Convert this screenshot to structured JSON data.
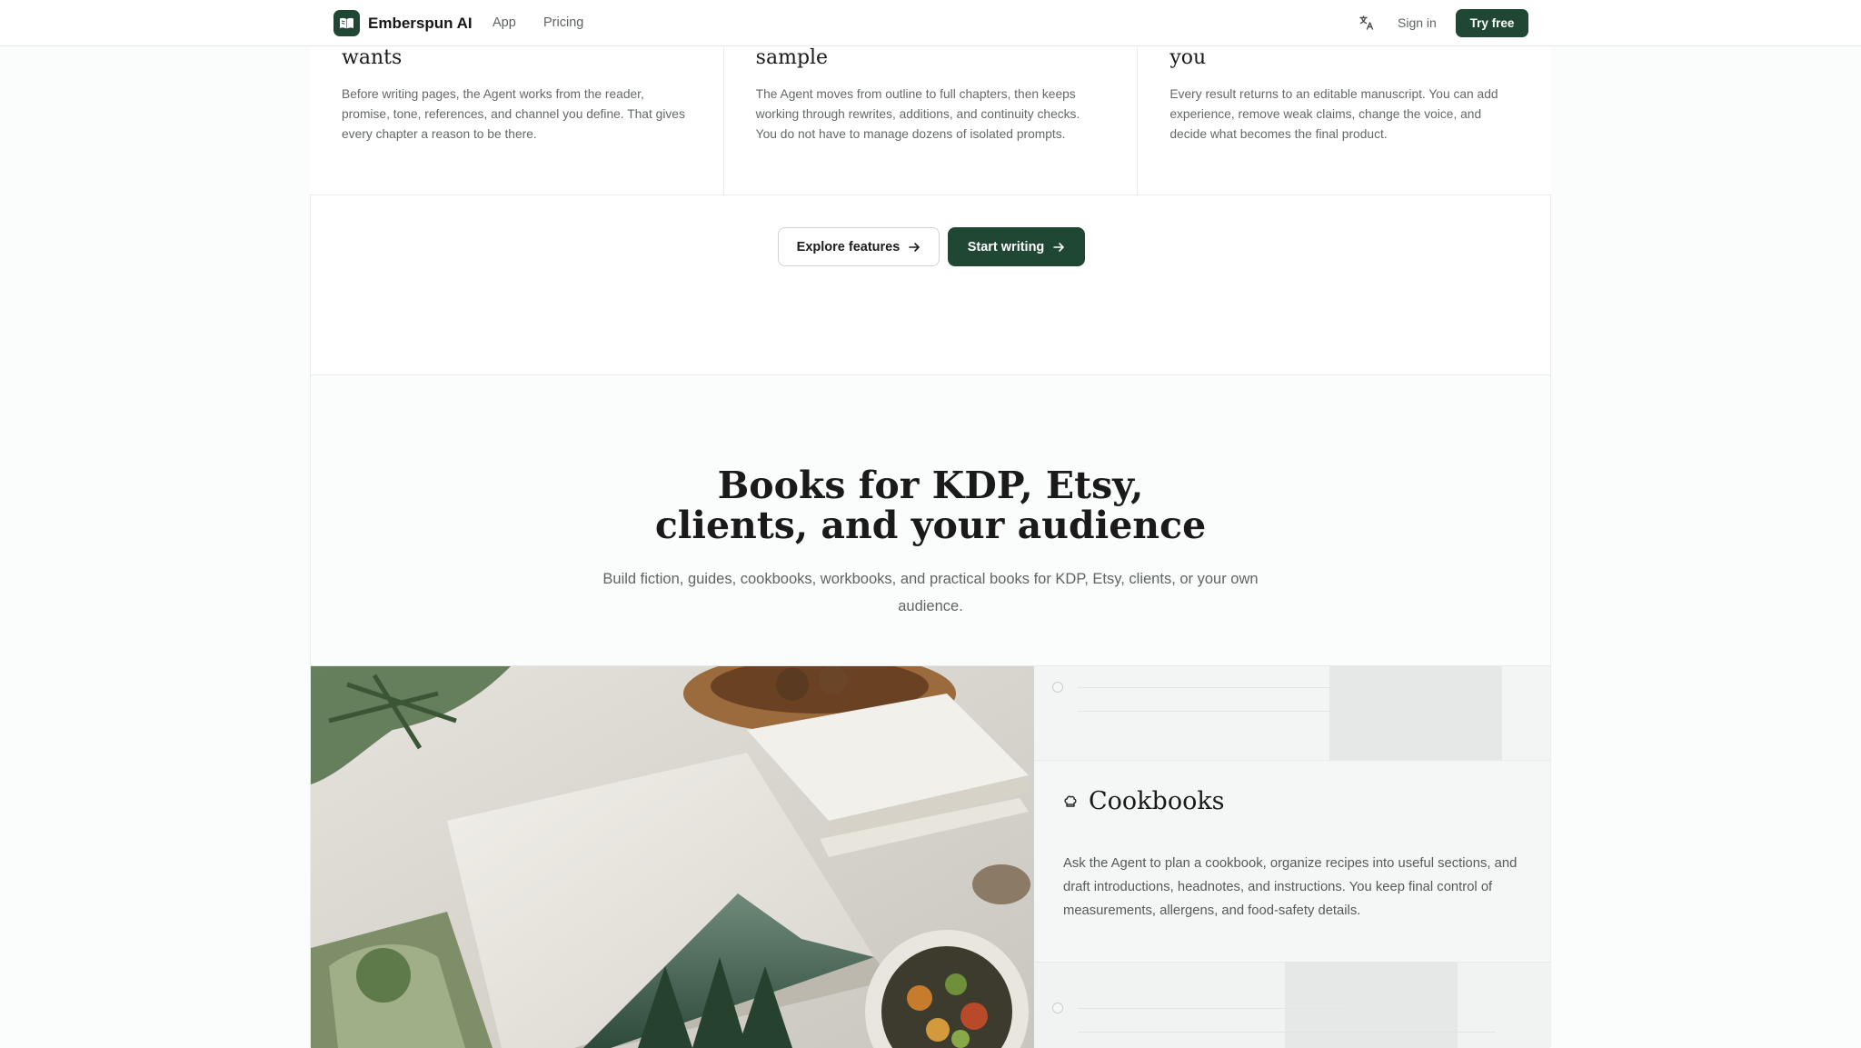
{
  "nav": {
    "brand": "Emberspun AI",
    "links": [
      "App",
      "Pricing"
    ],
    "sign_in": "Sign in",
    "try_free": "Try free",
    "icons": {
      "logo": "open-book-icon",
      "language": "translate-icon"
    }
  },
  "features": [
    {
      "title": "wants",
      "body": "Before writing pages, the Agent works from the reader, promise, tone, references, and channel you define. That gives every chapter a reason to be there."
    },
    {
      "title": "sample",
      "body": "The Agent moves from outline to full chapters, then keeps working through rewrites, additions, and continuity checks. You do not have to manage dozens of isolated prompts."
    },
    {
      "title": "you",
      "body": "Every result returns to an editable manuscript. You can add experience, remove weak claims, change the voice, and decide what becomes the final product."
    }
  ],
  "cta": {
    "explore": "Explore features",
    "start": "Start writing"
  },
  "books_section": {
    "title_line1": "Books for KDP, Etsy,",
    "title_line2": "clients, and your audience",
    "subtitle": "Build fiction, guides, cookbooks, workbooks, and practical books for KDP, Etsy, clients, or your own audience."
  },
  "showcase": {
    "card_title": "Cookbooks",
    "card_icon": "chef-hat-icon",
    "card_body": "Ask the Agent to plan a cookbook, organize recipes into useful sections, and draft introductions, headnotes, and instructions. You keep final control of measurements, allergens, and food-safety details."
  },
  "colors": {
    "brand_green": "#1f4733",
    "text_dark": "#1a1a1a",
    "text_muted": "#646868",
    "border": "#eceeee"
  }
}
